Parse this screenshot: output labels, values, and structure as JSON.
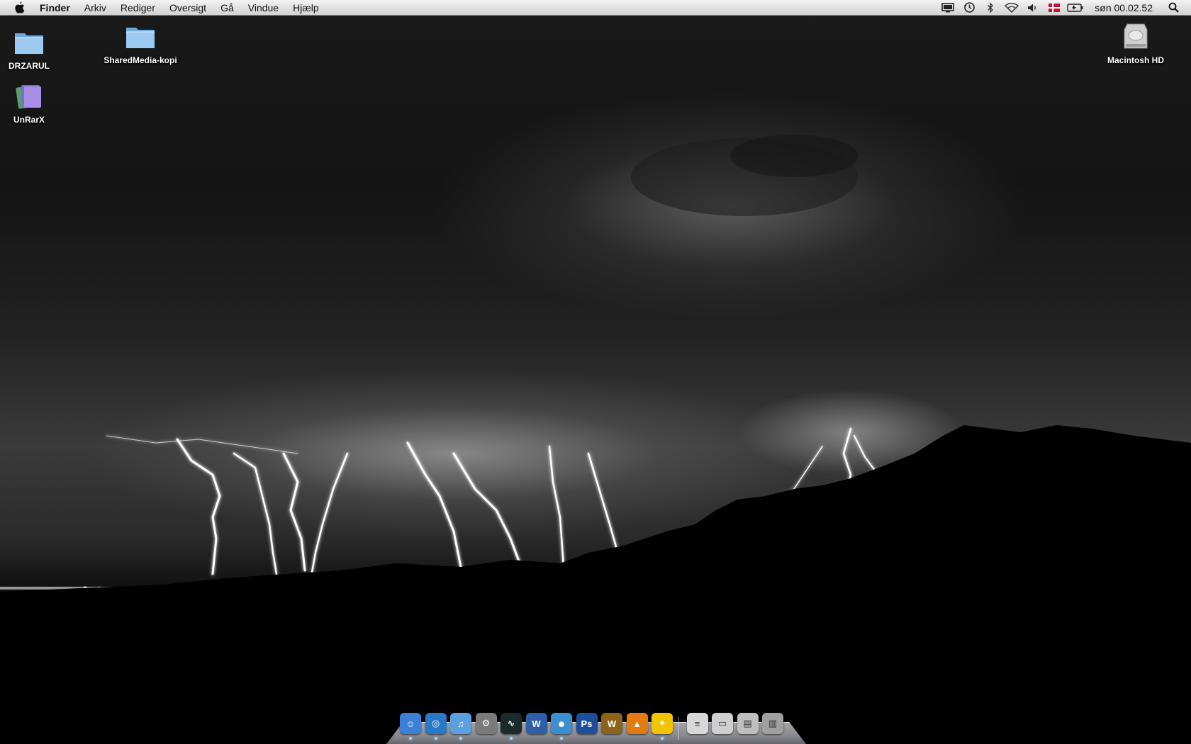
{
  "menubar": {
    "app_name": "Finder",
    "menus": [
      "Arkiv",
      "Rediger",
      "Oversigt",
      "Gå",
      "Vindue",
      "Hjælp"
    ],
    "status_icons": [
      "display-icon",
      "time-machine-icon",
      "bluetooth-icon",
      "wifi-icon",
      "volume-icon",
      "flag-dk-icon",
      "battery-icon"
    ],
    "clock": "søn 00.02.52",
    "flag_color": "#c8102e"
  },
  "desktop": {
    "icons": [
      {
        "label": "DRZARUL",
        "type": "folder-icon"
      },
      {
        "label": "SharedMedia-kopi",
        "type": "folder-icon"
      },
      {
        "label": "UnRarX",
        "type": "app-icon"
      },
      {
        "label": "Macintosh HD",
        "type": "hard-drive-icon"
      }
    ]
  },
  "dock": {
    "items": [
      {
        "name": "finder",
        "glyph": "☺",
        "color": "#3b7fd8",
        "running": true
      },
      {
        "name": "safari",
        "glyph": "◎",
        "color": "#2a78c8",
        "running": true
      },
      {
        "name": "itunes",
        "glyph": "♫",
        "color": "#5aa0e0",
        "running": true
      },
      {
        "name": "system-preferences",
        "glyph": "⚙",
        "color": "#7a7a7a",
        "running": false
      },
      {
        "name": "activity-monitor",
        "glyph": "∿",
        "color": "#1b2b2b",
        "running": true
      },
      {
        "name": "word",
        "glyph": "W",
        "color": "#2e5fa8",
        "running": false
      },
      {
        "name": "messenger",
        "glyph": "☻",
        "color": "#3a8fd0",
        "running": true
      },
      {
        "name": "photoshop",
        "glyph": "Ps",
        "color": "#1b4f9c",
        "running": false
      },
      {
        "name": "world-of-warcraft",
        "glyph": "W",
        "color": "#8a6418",
        "running": false
      },
      {
        "name": "vlc",
        "glyph": "▲",
        "color": "#e47a10",
        "running": false
      },
      {
        "name": "aim",
        "glyph": "✦",
        "color": "#f2c500",
        "running": true
      },
      {
        "name": "document-stack",
        "glyph": "≡",
        "color": "#d8d8d8",
        "running": false
      },
      {
        "name": "preview-stack",
        "glyph": "▭",
        "color": "#cfcfcf",
        "running": false
      },
      {
        "name": "downloads-stack",
        "glyph": "▤",
        "color": "#bfbfbf",
        "running": false
      },
      {
        "name": "trash",
        "glyph": "▥",
        "color": "#a0a0a0",
        "running": false
      }
    ]
  }
}
